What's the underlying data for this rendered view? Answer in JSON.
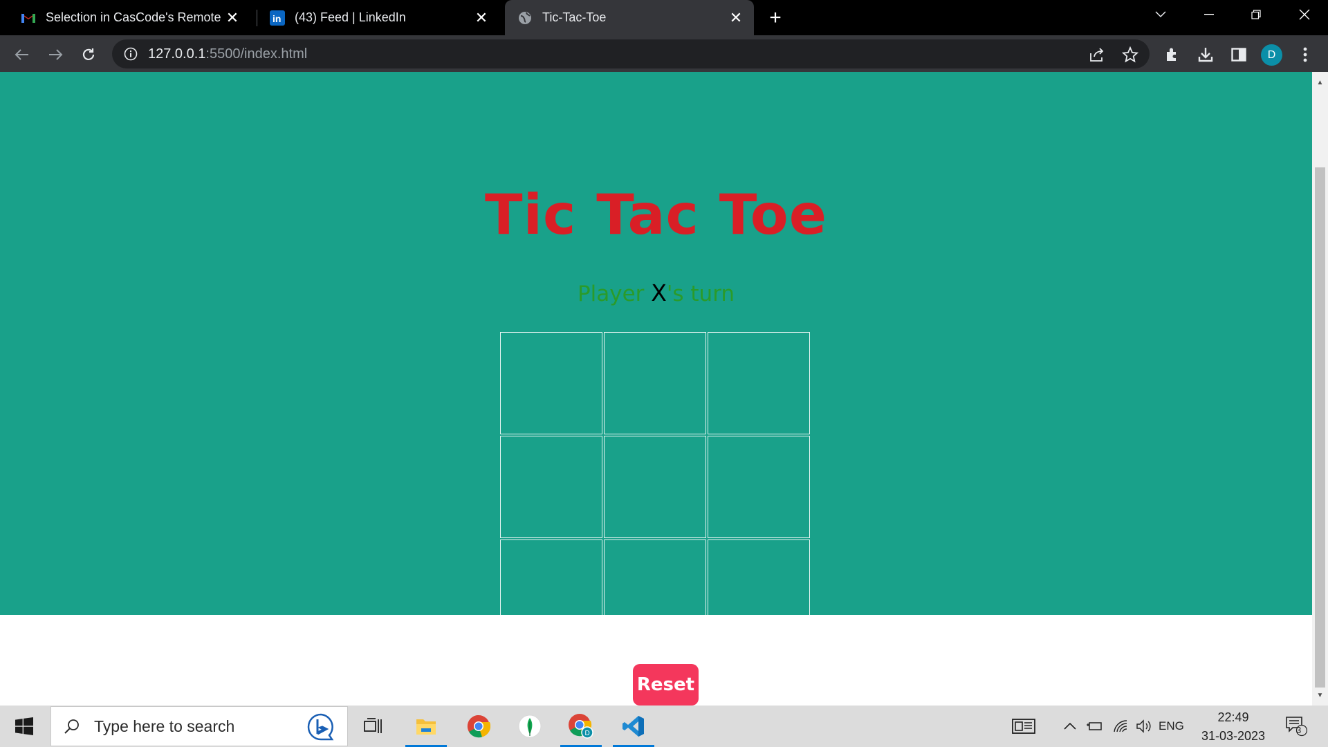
{
  "browser": {
    "tabs": [
      {
        "title": "Selection in CasCode's Remote In",
        "icon": "gmail-icon",
        "active": false
      },
      {
        "title": "(43) Feed | LinkedIn",
        "icon": "linkedin-icon",
        "active": false
      },
      {
        "title": "Tic-Tac-Toe",
        "icon": "globe-icon",
        "active": true
      }
    ],
    "url_host": "127.0.0.1",
    "url_rest": ":5500/index.html",
    "profile_initial": "D"
  },
  "page": {
    "title": "Tic Tac Toe",
    "turn_prefix": "Player ",
    "turn_player": "X",
    "turn_suffix": "'s turn",
    "board_cells": [
      "",
      "",
      "",
      "",
      "",
      "",
      "",
      "",
      ""
    ],
    "reset_label": "Reset",
    "colors": {
      "background": "#19a18a",
      "title": "#d91f26",
      "turn_text": "#2a9b2a",
      "reset_button": "#f4375c"
    }
  },
  "taskbar": {
    "search_placeholder": "Type here to search",
    "language": "ENG",
    "time": "22:49",
    "date": "31-03-2023",
    "notification_count": "3",
    "pinned_apps": [
      "task-view-icon",
      "file-explorer-icon",
      "chrome-icon",
      "mongodb-compass-icon",
      "chrome-profile-icon",
      "vscode-icon"
    ]
  }
}
